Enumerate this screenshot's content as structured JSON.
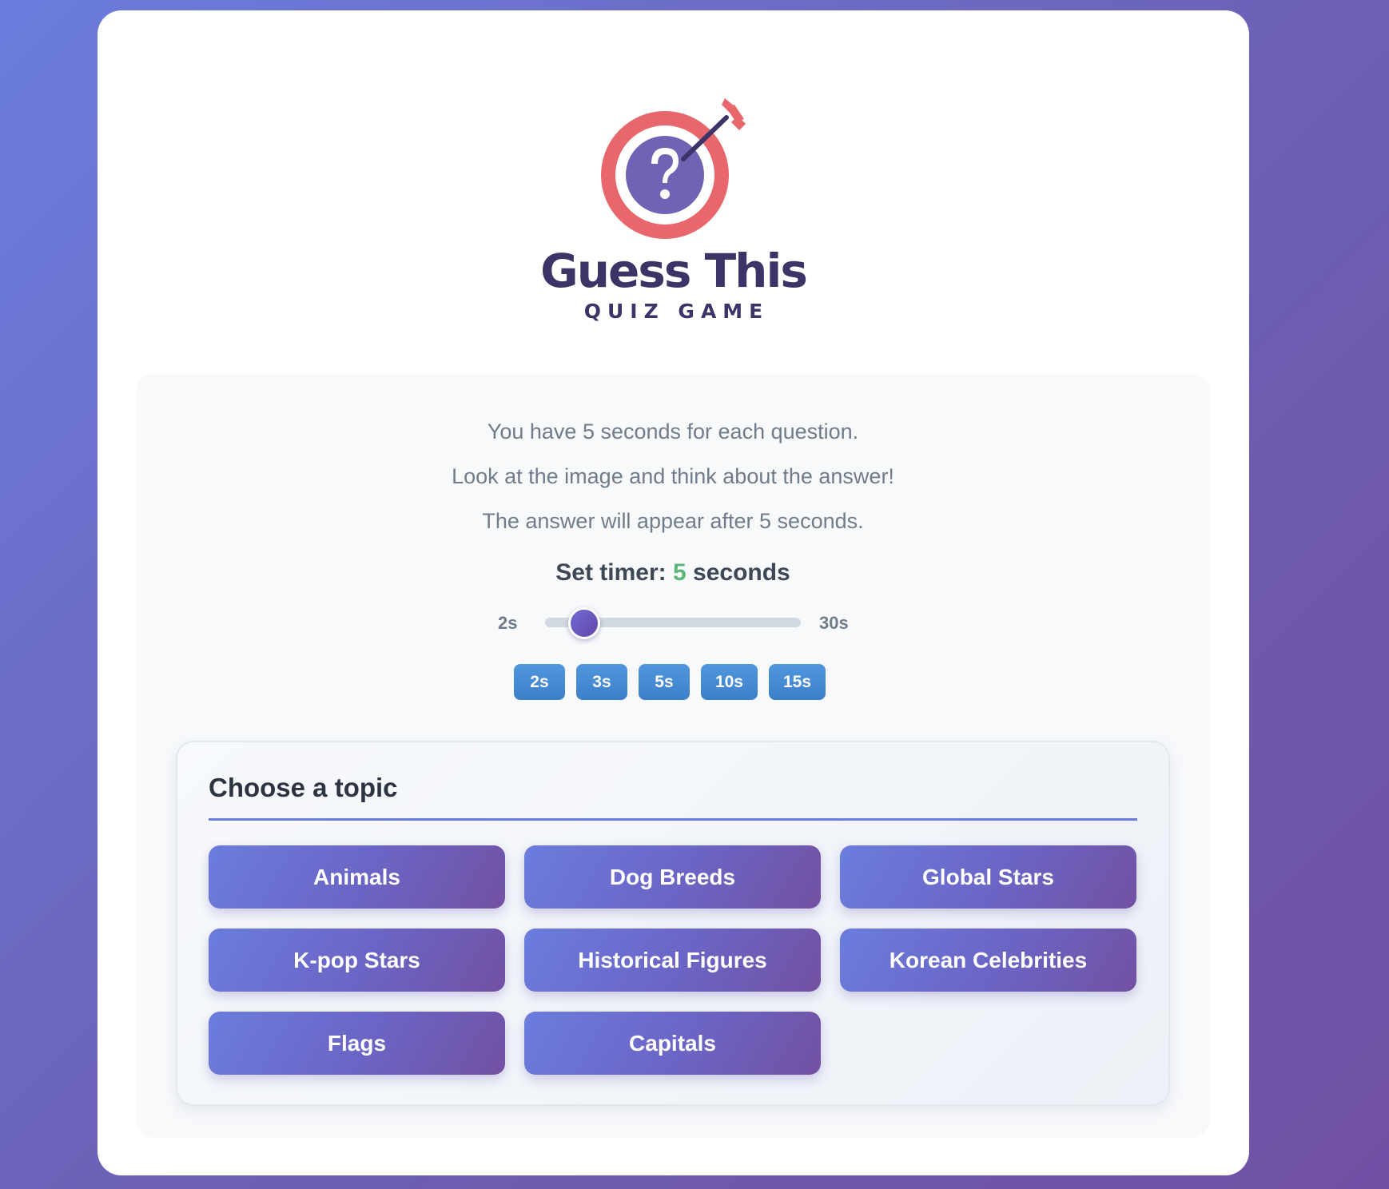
{
  "brand": {
    "title": "Guess This",
    "subtitle": "QUIZ GAME",
    "colors": {
      "ring": "#e8676c",
      "center": "#6f63b6",
      "text": "#3d3366"
    }
  },
  "instructions": {
    "line1": "You have 5 seconds for each question.",
    "line2": "Look at the image and think about the answer!",
    "line3": "The answer will appear after 5 seconds."
  },
  "timer": {
    "label_prefix": "Set timer:",
    "value": "5",
    "label_suffix": "seconds",
    "min_label": "2s",
    "max_label": "30s",
    "min": 2,
    "max": 30,
    "current": 5,
    "presets": [
      "2s",
      "3s",
      "5s",
      "10s",
      "15s"
    ]
  },
  "topics": {
    "heading": "Choose a topic",
    "items": [
      "Animals",
      "Dog Breeds",
      "Global Stars",
      "K-pop Stars",
      "Historical Figures",
      "Korean Celebrities",
      "Flags",
      "Capitals"
    ]
  },
  "colors": {
    "background_start": "#6b7ddd",
    "background_end": "#7050a3",
    "accent_green": "#5cb57a",
    "preset_blue": "#4a8fd6"
  }
}
